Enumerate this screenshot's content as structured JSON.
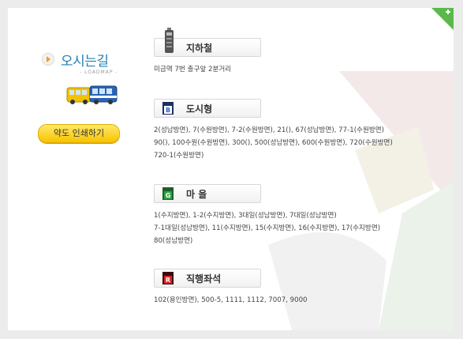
{
  "header": {
    "title": "오시는길",
    "subtitle": "- LOADMAP -"
  },
  "actions": {
    "print_label": "약도 인쇄하기"
  },
  "sections": [
    {
      "id": "subway",
      "icon": "subway-icon",
      "label": "지하철",
      "lines": [
        "미금역 7번 출구앞 2분거리"
      ]
    },
    {
      "id": "city-bus",
      "icon": "bus-b-icon",
      "label": "도시형",
      "lines": [
        "2(성남방면), 7(수원방면), 7-2(수원방면), 21(), 67(성남방면), 77-1(수원방면)",
        "90(), 100수원(수원방면), 300(), 500(성남방면), 600(수원방면), 720(수원방면)",
        "720-1(수원방면)"
      ]
    },
    {
      "id": "village-bus",
      "icon": "bus-g-icon",
      "label": "마 을",
      "lines": [
        "1(수지방면), 1-2(수지방면), 3대일(성남방면), 7대일(성남방면)",
        "7-1대일(성남방면), 11(수지방면), 15(수지방면), 16(수지방면), 17(수지방면)",
        "80(성남방면)"
      ]
    },
    {
      "id": "express-bus",
      "icon": "bus-r-icon",
      "label": "직행좌석",
      "lines": [
        "102(용인방면), 500-5, 1111, 1112, 7007, 9000"
      ]
    }
  ],
  "colors": {
    "title": "#1f7fb8",
    "button_yellow": "#f6c400",
    "city_bus_blue": "#2a64b5",
    "village_green": "#2da544",
    "express_red": "#d9262a",
    "corner_green": "#5bb84a"
  }
}
